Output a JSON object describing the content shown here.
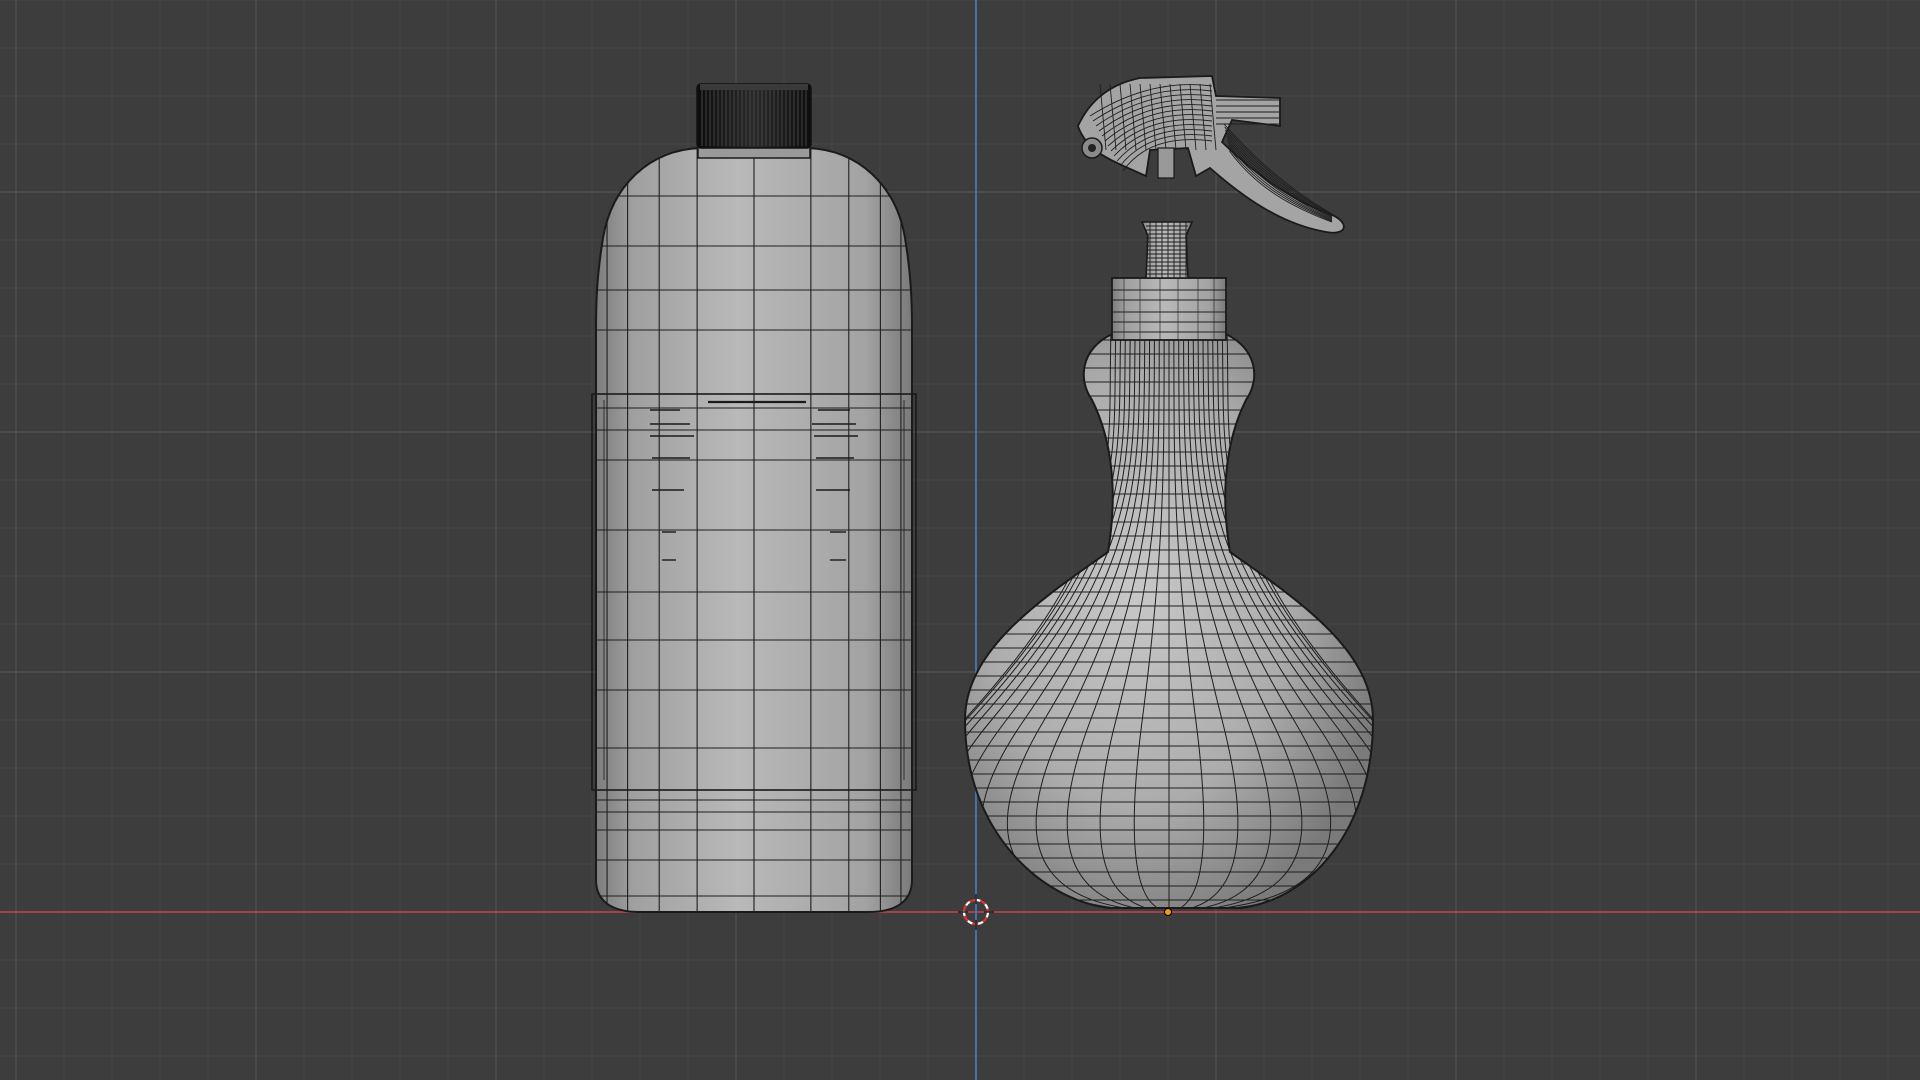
{
  "viewport": {
    "view": "front-orthographic",
    "background_color": "#3d3d3d",
    "grid_minor_color": "#474747",
    "grid_major_color": "#515151",
    "x_axis_color": "#c3414f",
    "z_axis_color": "#4b78c9",
    "shading": "solid-with-wireframe",
    "object_color": "#a9a9a9",
    "wire_color": "#1a1a1a",
    "cap_color": "#151515"
  },
  "scene": {
    "objects": [
      {
        "name": "bottle",
        "icon": "bottle-mesh-icon"
      },
      {
        "name": "spray-bottle",
        "icon": "spray-bottle-mesh-icon"
      }
    ],
    "cursor_icon": "3d-cursor-icon",
    "origin_icon": "object-origin-icon"
  }
}
